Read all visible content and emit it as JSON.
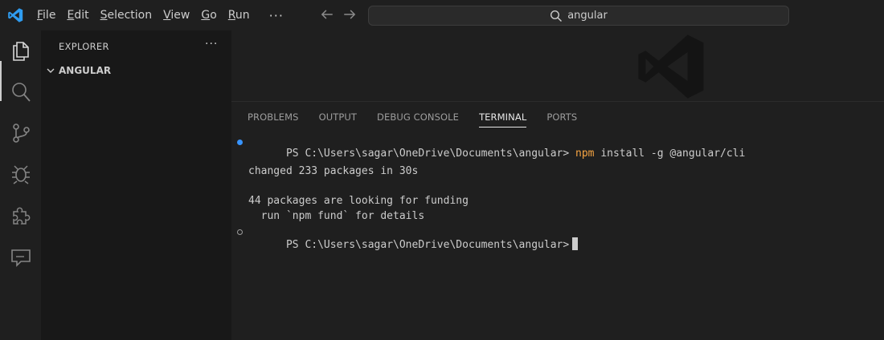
{
  "menu": {
    "items": [
      "File",
      "Edit",
      "Selection",
      "View",
      "Go",
      "Run"
    ],
    "more": "···"
  },
  "search": {
    "query": "angular"
  },
  "sidebar": {
    "title": "EXPLORER",
    "more": "···",
    "folder": "ANGULAR"
  },
  "panel": {
    "tabs": [
      "PROBLEMS",
      "OUTPUT",
      "DEBUG CONSOLE",
      "TERMINAL",
      "PORTS"
    ],
    "active_tab": "TERMINAL"
  },
  "terminal": {
    "prompt": "PS C:\\Users\\sagar\\OneDrive\\Documents\\angular>",
    "cmd_npm": "npm",
    "cmd_rest": "install -g @angular/cli",
    "line_changed": "changed 233 packages in 30s",
    "line_funding": "44 packages are looking for funding",
    "line_details": "  run `npm fund` for details"
  },
  "colors": {
    "accent": "#3794ff",
    "npm": "#f5a442",
    "vscode_blue": "#2f9cf0"
  },
  "icons": [
    "vscode-logo-icon",
    "arrow-left-icon",
    "arrow-right-icon",
    "search-icon",
    "files-icon",
    "search-activity-icon",
    "source-control-icon",
    "run-debug-icon",
    "extensions-icon",
    "chat-icon",
    "chevron-down-icon",
    "vscode-watermark-icon"
  ]
}
